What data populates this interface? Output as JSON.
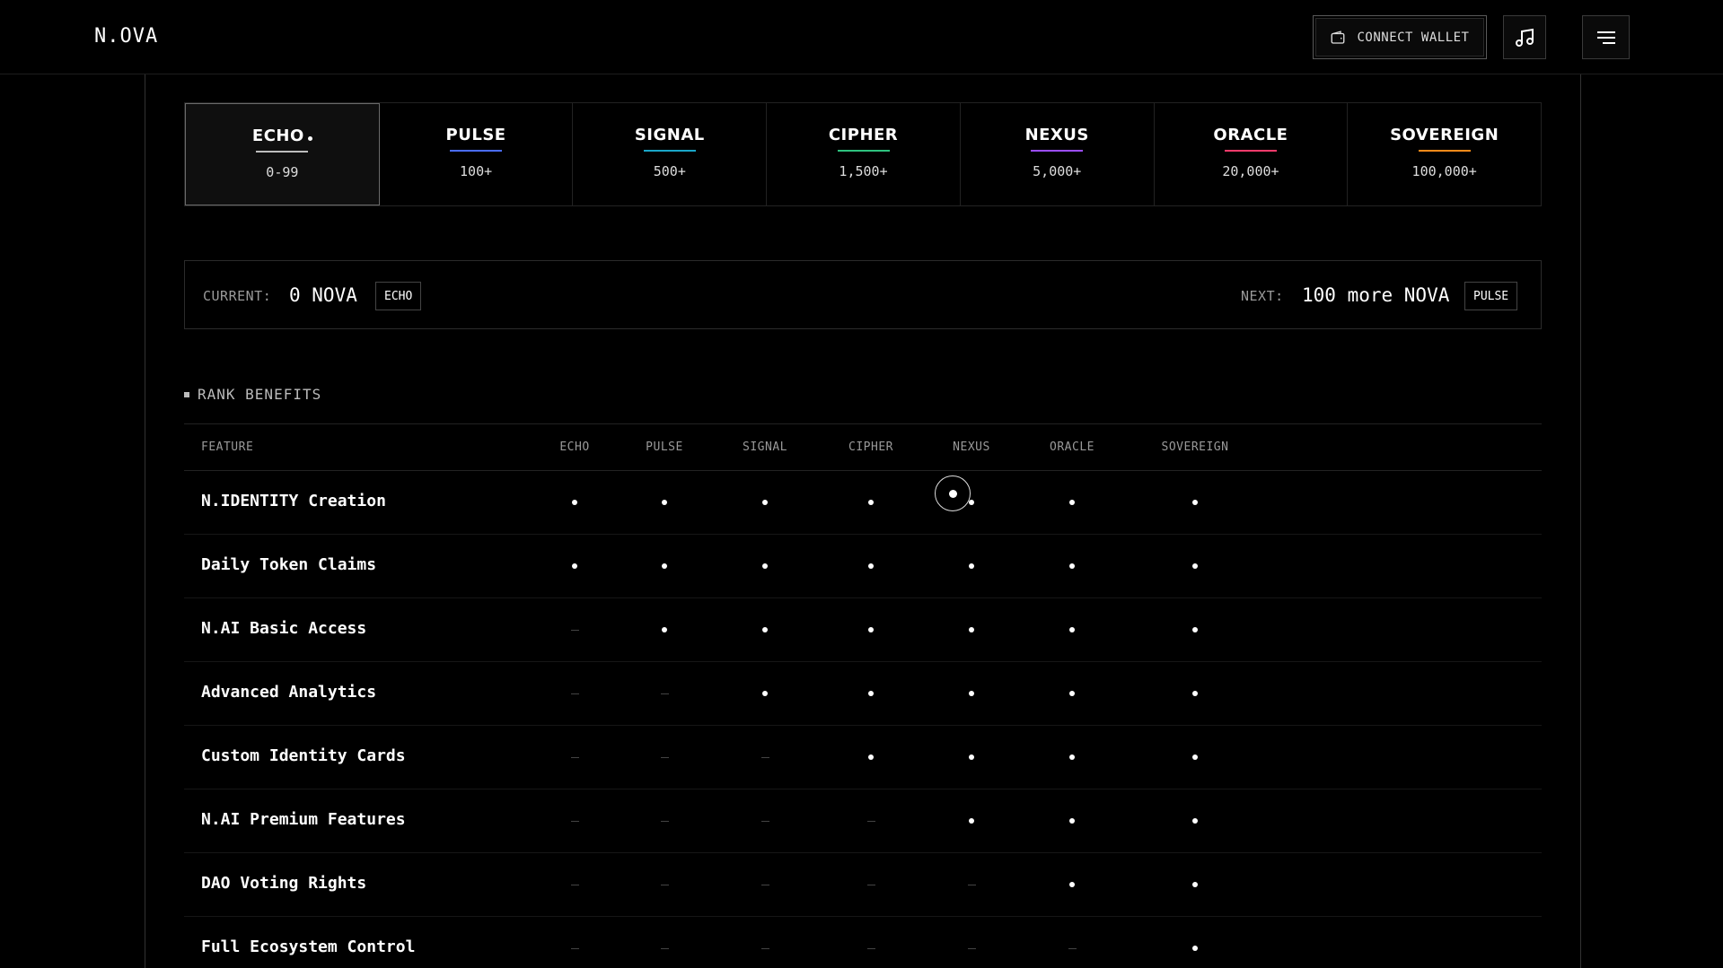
{
  "header": {
    "logo": "N.OVA",
    "connect_wallet": "CONNECT WALLET",
    "music_icon": "music-note-icon",
    "menu_icon": "menu-icon"
  },
  "ranks": [
    {
      "name": "ECHO",
      "range": "0-99",
      "color": "#bdbdbd",
      "active": true
    },
    {
      "name": "PULSE",
      "range": "100+",
      "color": "#4a6cff",
      "active": false
    },
    {
      "name": "SIGNAL",
      "range": "500+",
      "color": "#1aa6c8",
      "active": false
    },
    {
      "name": "CIPHER",
      "range": "1,500+",
      "color": "#2ec27e",
      "active": false
    },
    {
      "name": "NEXUS",
      "range": "5,000+",
      "color": "#9b4dff",
      "active": false
    },
    {
      "name": "ORACLE",
      "range": "20,000+",
      "color": "#ff3b6b",
      "active": false
    },
    {
      "name": "SOVEREIGN",
      "range": "100,000+",
      "color": "#ff8a1a",
      "active": false
    }
  ],
  "status": {
    "current_label": "CURRENT:",
    "current_value": "0 NOVA",
    "current_tag": "ECHO",
    "next_label": "NEXT:",
    "next_value": "100 more NOVA",
    "next_tag": "PULSE"
  },
  "benefits": {
    "title": "RANK BENEFITS",
    "headers": [
      "FEATURE",
      "ECHO",
      "PULSE",
      "SIGNAL",
      "CIPHER",
      "NEXUS",
      "ORACLE",
      "SOVEREIGN"
    ],
    "rows": [
      {
        "feature": "N.IDENTITY Creation",
        "values": [
          1,
          1,
          1,
          1,
          1,
          1,
          1
        ]
      },
      {
        "feature": "Daily Token Claims",
        "values": [
          1,
          1,
          1,
          1,
          1,
          1,
          1
        ]
      },
      {
        "feature": "N.AI Basic Access",
        "values": [
          0,
          1,
          1,
          1,
          1,
          1,
          1
        ]
      },
      {
        "feature": "Advanced Analytics",
        "values": [
          0,
          0,
          1,
          1,
          1,
          1,
          1
        ]
      },
      {
        "feature": "Custom Identity Cards",
        "values": [
          0,
          0,
          0,
          1,
          1,
          1,
          1
        ]
      },
      {
        "feature": "N.AI Premium Features",
        "values": [
          0,
          0,
          0,
          0,
          1,
          1,
          1
        ]
      },
      {
        "feature": "DAO Voting Rights",
        "values": [
          0,
          0,
          0,
          0,
          0,
          1,
          1
        ]
      },
      {
        "feature": "Full Ecosystem Control",
        "values": [
          0,
          0,
          0,
          0,
          0,
          0,
          1
        ]
      }
    ]
  }
}
